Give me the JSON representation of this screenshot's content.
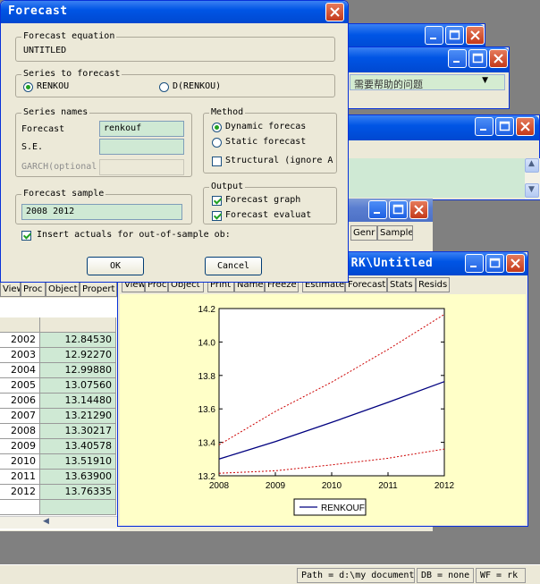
{
  "dialog": {
    "title": "Forecast",
    "forecast_equation": {
      "label": "Forecast equation",
      "value": "UNTITLED"
    },
    "series_to_forecast": {
      "label": "Series to forecast",
      "option1": "RENKOU",
      "option2": "D(RENKOU)",
      "selected": "RENKOU"
    },
    "series_names": {
      "label": "Series names",
      "forecast_label": "Forecast",
      "forecast_value": "renkouf",
      "se_label": "S.E.",
      "se_value": "",
      "garch_label": "GARCH(optional",
      "garch_value": ""
    },
    "method": {
      "label": "Method",
      "dynamic": "Dynamic forecas",
      "static": "Static forecast",
      "structural": "Structural (ignore A",
      "selected": "dynamic",
      "structural_checked": false
    },
    "forecast_sample": {
      "label": "Forecast sample",
      "value": "2008 2012"
    },
    "output": {
      "label": "Output",
      "graph": "Forecast graph",
      "evaluation": "Forecast evaluat",
      "graph_checked": true,
      "evaluation_checked": true
    },
    "insert_actuals": {
      "label": "Insert actuals for out-of-sample ob:",
      "checked": true
    },
    "ok_label": "OK",
    "cancel_label": "Cancel"
  },
  "background": {
    "help_placeholder": "需要帮助的问题",
    "genr_label": "Genr",
    "sample_label": "Sample"
  },
  "spreadsheet": {
    "toolbar": [
      "View",
      "Proc",
      "Object",
      "Propert"
    ],
    "rows": [
      {
        "year": "2002",
        "value": "12.84530"
      },
      {
        "year": "2003",
        "value": "12.92270"
      },
      {
        "year": "2004",
        "value": "12.99880"
      },
      {
        "year": "2005",
        "value": "13.07560"
      },
      {
        "year": "2006",
        "value": "13.14480"
      },
      {
        "year": "2007",
        "value": "13.21290"
      },
      {
        "year": "2008",
        "value": "13.30217"
      },
      {
        "year": "2009",
        "value": "13.40578"
      },
      {
        "year": "2010",
        "value": "13.51910"
      },
      {
        "year": "2011",
        "value": "13.63900"
      },
      {
        "year": "2012",
        "value": "13.76335"
      }
    ]
  },
  "equation_window": {
    "title": ": RK\\Untitled",
    "toolbar": [
      "View",
      "Proc",
      "Object",
      "Print",
      "Name",
      "Freeze",
      "Estimate",
      "Forecast",
      "Stats",
      "Resids"
    ]
  },
  "chart_data": {
    "type": "line",
    "x": [
      2008,
      2009,
      2010,
      2011,
      2012
    ],
    "xticks": [
      "2008",
      "2009",
      "2010",
      "2011",
      "2012"
    ],
    "yticks": [
      "13.2",
      "13.4",
      "13.6",
      "13.8",
      "14.0",
      "14.2"
    ],
    "ylim": [
      13.2,
      14.2
    ],
    "xlim": [
      2008,
      2012
    ],
    "series": [
      {
        "name": "RENKOUF",
        "style": "solid",
        "color": "#00007f",
        "values": [
          13.3,
          13.405,
          13.519,
          13.639,
          13.763
        ]
      },
      {
        "style": "dashed",
        "color": "#cc0000",
        "values": [
          13.385,
          13.585,
          13.76,
          13.955,
          14.165
        ]
      },
      {
        "style": "dashed",
        "color": "#cc0000",
        "values": [
          13.215,
          13.23,
          13.265,
          13.305,
          13.36
        ]
      }
    ],
    "legend_position": "bottom-center"
  },
  "statusbar": {
    "path": "Path = d:\\my document",
    "db": "DB = none",
    "wf": "WF = rk"
  }
}
